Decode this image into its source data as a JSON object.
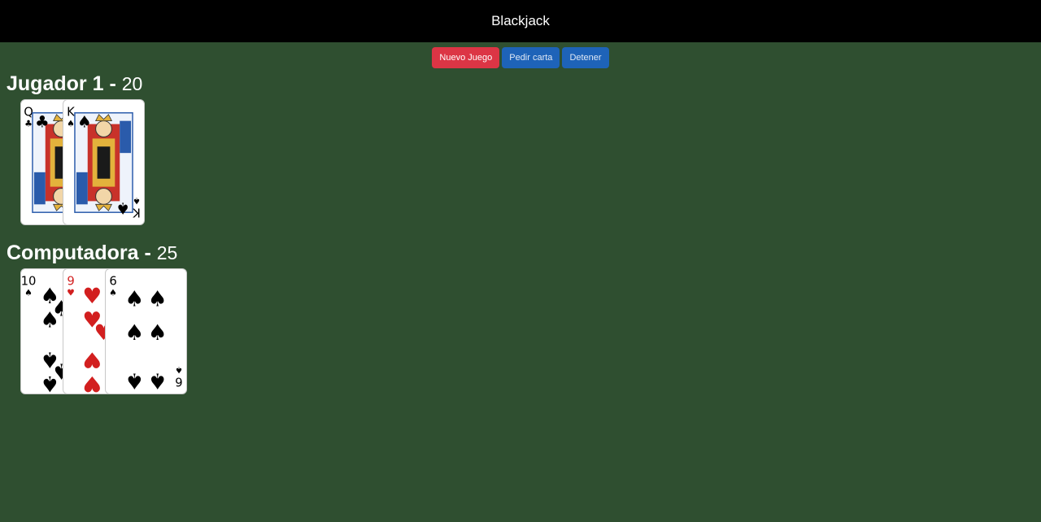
{
  "header": {
    "title": "Blackjack"
  },
  "controls": {
    "new_game": "Nuevo Juego",
    "hit": "Pedir carta",
    "stand": "Detener"
  },
  "players": [
    {
      "name": "Jugador 1",
      "separator": "-",
      "score": "20",
      "cards": [
        {
          "rank": "Q",
          "suit": "clubs",
          "color": "#000000"
        },
        {
          "rank": "K",
          "suit": "spades",
          "color": "#000000"
        }
      ]
    },
    {
      "name": "Computadora",
      "separator": "-",
      "score": "25",
      "cards": [
        {
          "rank": "10",
          "suit": "spades",
          "color": "#000000"
        },
        {
          "rank": "9",
          "suit": "hearts",
          "color": "#d21f1f"
        },
        {
          "rank": "6",
          "suit": "spades",
          "color": "#000000"
        }
      ]
    }
  ],
  "colors": {
    "table": "#2f4f30",
    "header": "#000000",
    "new_game_button": "#dc3545",
    "action_button": "#1e63b8"
  }
}
